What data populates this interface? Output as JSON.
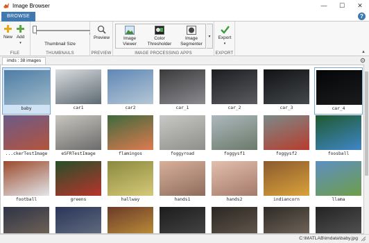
{
  "window": {
    "title": "Image Browser"
  },
  "tabs": [
    {
      "label": "BROWSE"
    }
  ],
  "toolstrip": {
    "file": {
      "new_label": "New",
      "add_label": "Add",
      "section_label": "FILE"
    },
    "thumbnails": {
      "size_label": "Thumbnail Size",
      "section_label": "THUMBNAILS",
      "slider_value": 0
    },
    "preview": {
      "preview_label": "Preview",
      "section_label": "PREVIEW"
    },
    "apps": {
      "section_label": "IMAGE PROCESSING APPS",
      "items": [
        {
          "line1": "Image",
          "line2": "Viewer"
        },
        {
          "line1": "Color",
          "line2": "Thresholder"
        },
        {
          "line1": "Image",
          "line2": "Segmenter"
        }
      ]
    },
    "export": {
      "export_label": "Export",
      "section_label": "EXPORT"
    }
  },
  "browser": {
    "tab_label": "imds : 38 images"
  },
  "images": [
    {
      "name": "baby",
      "colors": [
        "#4e7da6",
        "#9db8c8"
      ]
    },
    {
      "name": "car1",
      "colors": [
        "#d9dcdf",
        "#5d6a72"
      ]
    },
    {
      "name": "car2",
      "colors": [
        "#5f87b7",
        "#b5c7d4"
      ]
    },
    {
      "name": "car_1",
      "colors": [
        "#3a3a3c",
        "#8b8b90"
      ]
    },
    {
      "name": "car_2",
      "colors": [
        "#1b1d20",
        "#5a5c60"
      ]
    },
    {
      "name": "car_3",
      "colors": [
        "#101214",
        "#45484c"
      ]
    },
    {
      "name": "car_4",
      "colors": [
        "#040506",
        "#1a1c1e"
      ]
    },
    {
      "name": "...ckerTestImage",
      "colors": [
        "#6b5a8a",
        "#b4543b"
      ]
    },
    {
      "name": "eSFRTestImage",
      "colors": [
        "#c9c6bf",
        "#6b6b6b"
      ]
    },
    {
      "name": "flamingos",
      "colors": [
        "#3d6a3d",
        "#e07a4f"
      ]
    },
    {
      "name": "foggyroad",
      "colors": [
        "#c8c9c6",
        "#8e8f8a"
      ]
    },
    {
      "name": "foggysf1",
      "colors": [
        "#aeb8bd",
        "#6a7a6a"
      ]
    },
    {
      "name": "foggysf2",
      "colors": [
        "#7b8a8a",
        "#b83c2c"
      ]
    },
    {
      "name": "foosball",
      "colors": [
        "#1e5a2e",
        "#3f86c8"
      ]
    },
    {
      "name": "football",
      "colors": [
        "#9c4a2c",
        "#e2e6ea"
      ]
    },
    {
      "name": "greens",
      "colors": [
        "#274f2a",
        "#b8342c"
      ]
    },
    {
      "name": "hallway",
      "colors": [
        "#8a8a3e",
        "#d6c879"
      ]
    },
    {
      "name": "hands1",
      "colors": [
        "#d8b09a",
        "#8e6d5e"
      ]
    },
    {
      "name": "hands2",
      "colors": [
        "#e3bfae",
        "#a57a6a"
      ]
    },
    {
      "name": "indiancorn",
      "colors": [
        "#8b5a2e",
        "#d9a23a"
      ]
    },
    {
      "name": "llama",
      "colors": [
        "#5e8fc2",
        "#6e9e4a"
      ]
    },
    {
      "name": "",
      "colors": [
        "#2d3347",
        "#7a6a58"
      ]
    },
    {
      "name": "",
      "colors": [
        "#2a3558",
        "#6a7486"
      ]
    },
    {
      "name": "",
      "colors": [
        "#6a3a2a",
        "#c89a3a"
      ]
    },
    {
      "name": "",
      "colors": [
        "#1c1c1c",
        "#4a4a4a"
      ]
    },
    {
      "name": "",
      "colors": [
        "#2a2622",
        "#6a5e52"
      ]
    },
    {
      "name": "",
      "colors": [
        "#2e2a26",
        "#7a6e62"
      ]
    },
    {
      "name": "",
      "colors": [
        "#222222",
        "#5a5a5a"
      ]
    }
  ],
  "status": {
    "path": "C:\\MATLAB\\imdata\\baby.jpg"
  }
}
